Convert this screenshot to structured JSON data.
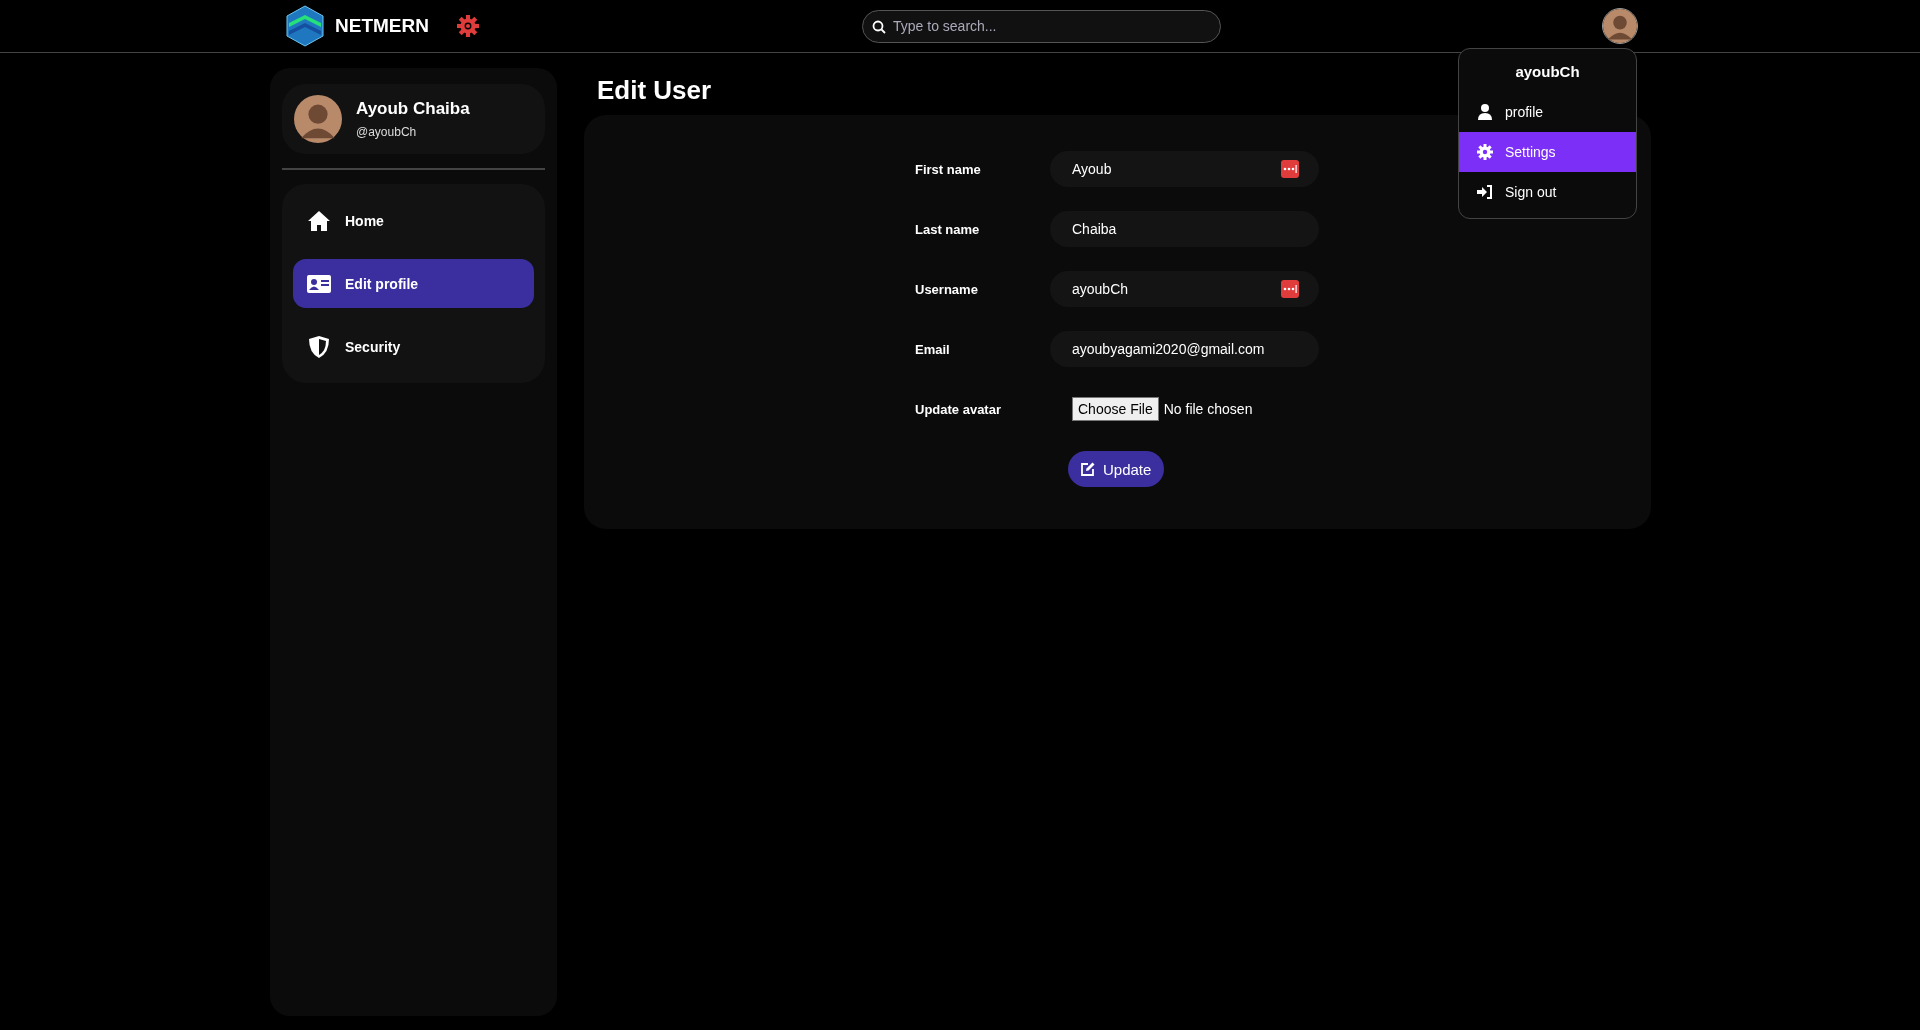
{
  "header": {
    "logo_text": "NETMERN",
    "search": {
      "placeholder": "Type to search..."
    }
  },
  "sidebar": {
    "user": {
      "name": "Ayoub Chaiba",
      "handle": "@ayoubCh"
    },
    "nav": [
      {
        "label": "Home",
        "kind": "home",
        "selected": false
      },
      {
        "label": "Edit profile",
        "kind": "id-card",
        "selected": true
      },
      {
        "label": "Security",
        "kind": "shield",
        "selected": false
      }
    ]
  },
  "page_title": "Edit User",
  "form": {
    "fields": [
      {
        "kind": "text",
        "label": "First name",
        "value": "Ayoub",
        "autofill_icon": true
      },
      {
        "kind": "text",
        "label": "Last name",
        "value": "Chaiba",
        "autofill_icon": false
      },
      {
        "kind": "text",
        "label": "Username",
        "value": "ayoubCh",
        "autofill_icon": true
      },
      {
        "kind": "text",
        "label": "Email",
        "value": "ayoubyagami2020@gmail.com",
        "autofill_icon": false
      },
      {
        "kind": "file",
        "label": "Update avatar",
        "button": "Choose File",
        "status": "No file chosen"
      }
    ],
    "submit": "Update"
  },
  "user_menu": {
    "username": "ayoubCh",
    "items": [
      {
        "label": "profile",
        "kind": "user",
        "selected": false
      },
      {
        "label": "Settings",
        "kind": "gear",
        "selected": true
      },
      {
        "label": "Sign out",
        "kind": "sign-in",
        "selected": false
      }
    ]
  }
}
